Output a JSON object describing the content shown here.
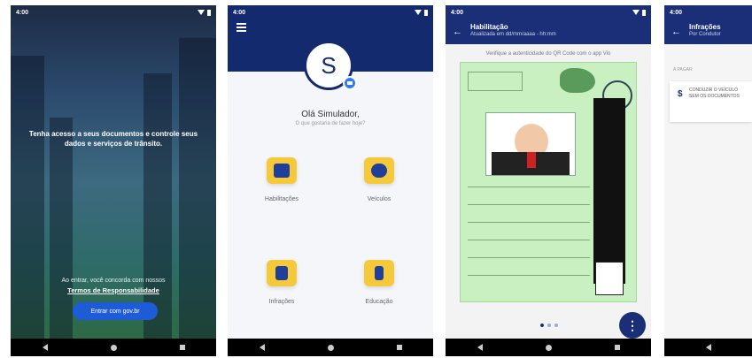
{
  "status": {
    "time": "4:00"
  },
  "screen1": {
    "welcome": "Tenha acesso a seus documentos e controle seus dados e serviços de trânsito.",
    "terms_prefix": "Ao entrar, você concorda com nossos",
    "terms_link": "Termos de Responsabilidade",
    "enter_button": "Entrar com gov.br"
  },
  "screen2": {
    "avatar_initial": "S",
    "greeting": "Olá Simulador,",
    "subtitle": "O que gostaria de fazer hoje?",
    "tiles": [
      {
        "label": "Habilitações",
        "icon": "id-card-icon"
      },
      {
        "label": "Veículos",
        "icon": "car-icon"
      },
      {
        "label": "Infrações",
        "icon": "document-icon"
      },
      {
        "label": "Educação",
        "icon": "traffic-light-icon"
      }
    ]
  },
  "screen3": {
    "title": "Habilitação",
    "subtitle": "Atualizada em dd/mm/aaaa - hh:mm",
    "verify_text": "Verifique a autenticidade do QR Code com o app Vio",
    "fab_label": "⋮"
  },
  "screen4": {
    "title": "Infrações",
    "subtitle": "Por Condutor",
    "section_label": "A PAGAR",
    "item": {
      "icon_symbol": "$",
      "description": "CONDUZIR O VEÍCULO SEM OS DOCUMENTOS",
      "meta": "",
      "tag": ""
    }
  },
  "colors": {
    "primary": "#132a6e",
    "accent": "#f6c93b",
    "button": "#1e5bd6",
    "license": "#c8f0c0"
  }
}
